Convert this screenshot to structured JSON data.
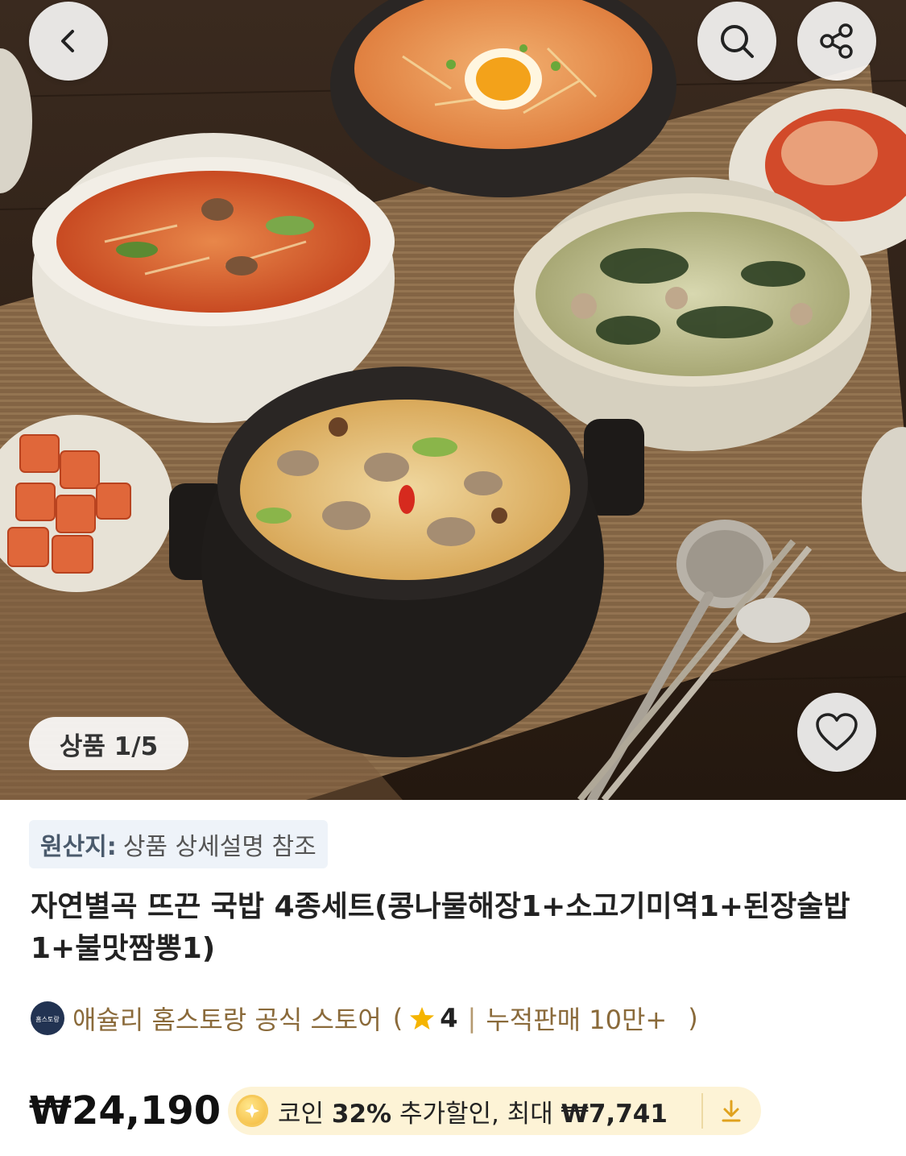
{
  "header": {
    "back_icon": "chevron-left-icon",
    "search_icon": "search-icon",
    "share_icon": "share-icon"
  },
  "gallery": {
    "counter": "상품 1/5",
    "like_icon": "heart-outline-icon"
  },
  "product": {
    "origin_label": "원산지:",
    "origin_value": "상품 상세설명 참조",
    "title": "자연별곡 뜨끈 국밥 4종세트(콩나물해장1+소고기미역1+된장술밥1+불맛짬뽕1)"
  },
  "seller": {
    "logo_text": "홈스토랑",
    "name": "애슐리 홈스토랑 공식 스토어",
    "open_paren": "(",
    "rating": "4",
    "sales_label": "누적판매 10만+",
    "close_paren": ")"
  },
  "pricing": {
    "price": "₩24,190",
    "coin_label": "코인",
    "coin_percent": "32%",
    "coin_text": "추가할인, 최대",
    "coin_max": "₩7,741"
  },
  "colors": {
    "seller_text": "#8a6a3a",
    "coupon_bg": "#fdf3d6",
    "star": "#f5b400",
    "origin_bg": "#eef3f9"
  }
}
